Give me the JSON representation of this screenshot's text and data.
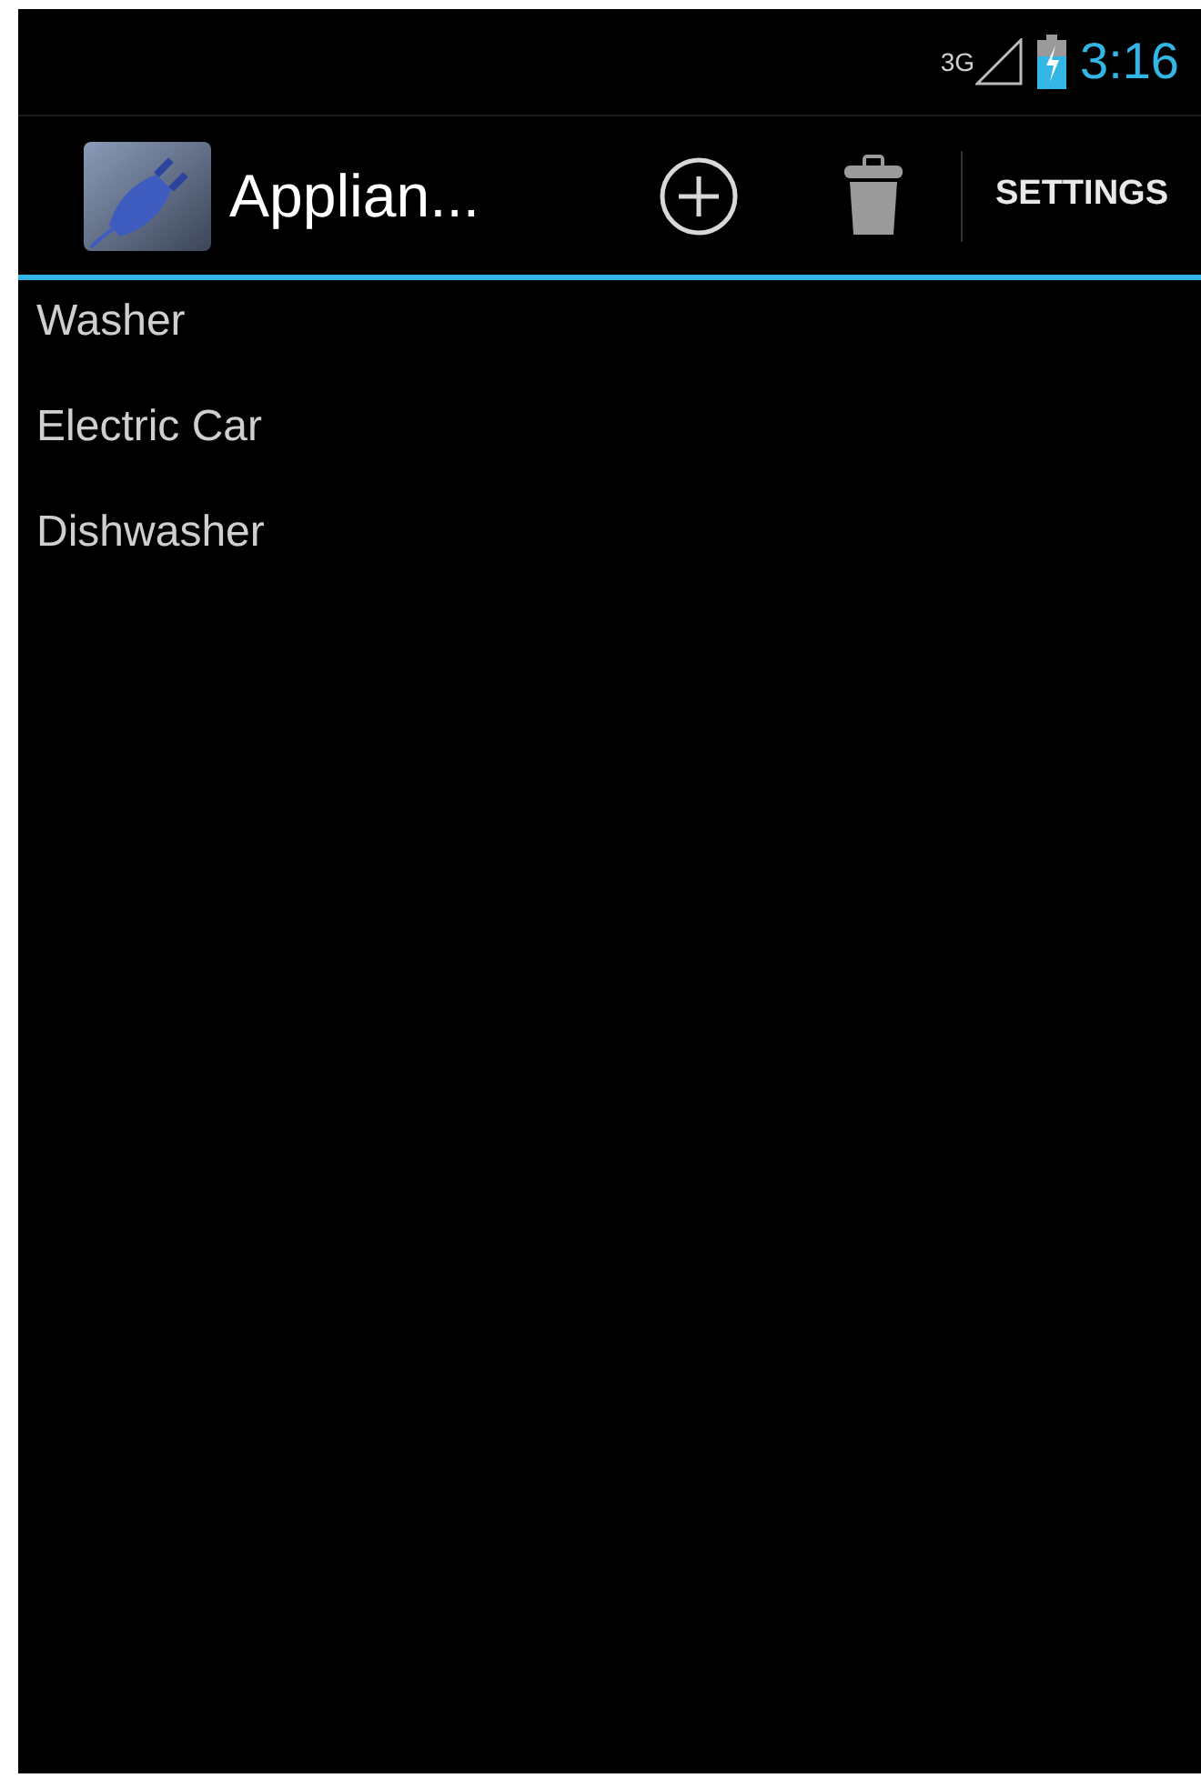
{
  "status_bar": {
    "network": "3G",
    "time": "3:16"
  },
  "action_bar": {
    "title": "Applian...",
    "actions": [
      {
        "kind": "add"
      },
      {
        "kind": "delete"
      },
      {
        "kind": "text",
        "label": "SETTINGS"
      }
    ]
  },
  "list": {
    "items": [
      {
        "label": "Washer"
      },
      {
        "label": "Electric Car"
      },
      {
        "label": "Dishwasher"
      }
    ]
  }
}
